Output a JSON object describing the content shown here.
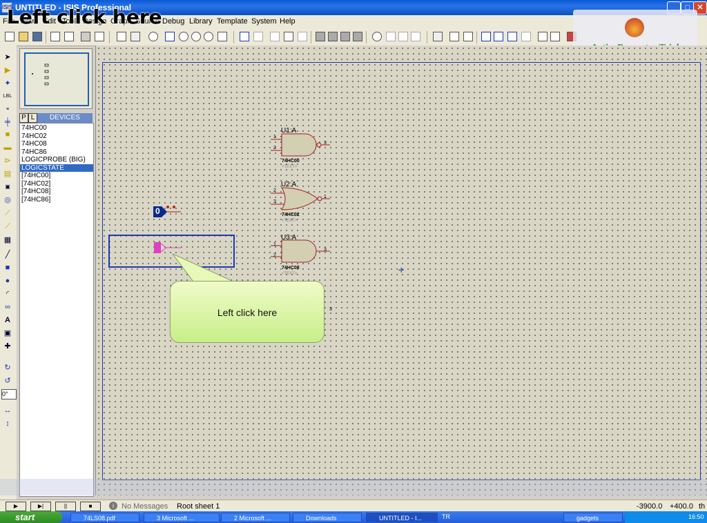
{
  "window": {
    "title": "UNTITLED - ISIS Professional",
    "app_icon": "ISIS"
  },
  "overlay_caption": "Left click here",
  "menu": [
    "File",
    "View",
    "Edit",
    "Tools",
    "Design",
    "Graph",
    "Source",
    "Debug",
    "Library",
    "Template",
    "System",
    "Help"
  ],
  "trial_badge": "ActivePresenter Trial",
  "device_panel": {
    "tab_p": "P",
    "tab_l": "L",
    "title": "DEVICES",
    "items": [
      "74HC00",
      "74HC02",
      "74HC08",
      "74HC86",
      "LOGICPROBE (BIG)",
      "LOGICSTATE",
      "[74HC00]",
      "[74HC02]",
      "[74HC08]",
      "[74HC86]"
    ],
    "selected_index": 5
  },
  "rotation_value": "0°",
  "components": [
    {
      "ref": "U1:A",
      "part": "74HC00",
      "text": "<TEXT>",
      "pins": [
        "1",
        "2",
        "3"
      ],
      "gate": "nand"
    },
    {
      "ref": "U2:A",
      "part": "74HC02",
      "text": "<TEXT>",
      "pins": [
        "2",
        "3",
        "1"
      ],
      "gate": "nor"
    },
    {
      "ref": "U3:A",
      "part": "74HC08",
      "text": "<TEXT>",
      "pins": [
        "1",
        "2",
        "3"
      ],
      "gate": "and"
    }
  ],
  "logic_state_value": "0",
  "stray_pin": "3",
  "callout": "Left click here",
  "status": {
    "messages": "No Messages",
    "sheet": "Root sheet 1",
    "x": "-3900.0",
    "y": "+400.0",
    "unit": "th"
  },
  "taskbar": {
    "start": "start",
    "tasks": [
      "74LS08.pdf",
      "3 Microsoft ...",
      "2 Microsoft ...",
      "Downloads",
      "UNTITLED - I...",
      "gadgets"
    ],
    "tray_lang": "TR",
    "clock": "16:50"
  },
  "colors": {
    "titlebar": "#0a5bd9",
    "canvas": "#d9d6c6",
    "sheet_border": "#1a3ab0",
    "gate_fill": "#d3cfb3",
    "gate_stroke": "#a02020",
    "logicstate": "#0a2a8a",
    "probe": "#e040c0",
    "callout": "#d8f4a0"
  }
}
